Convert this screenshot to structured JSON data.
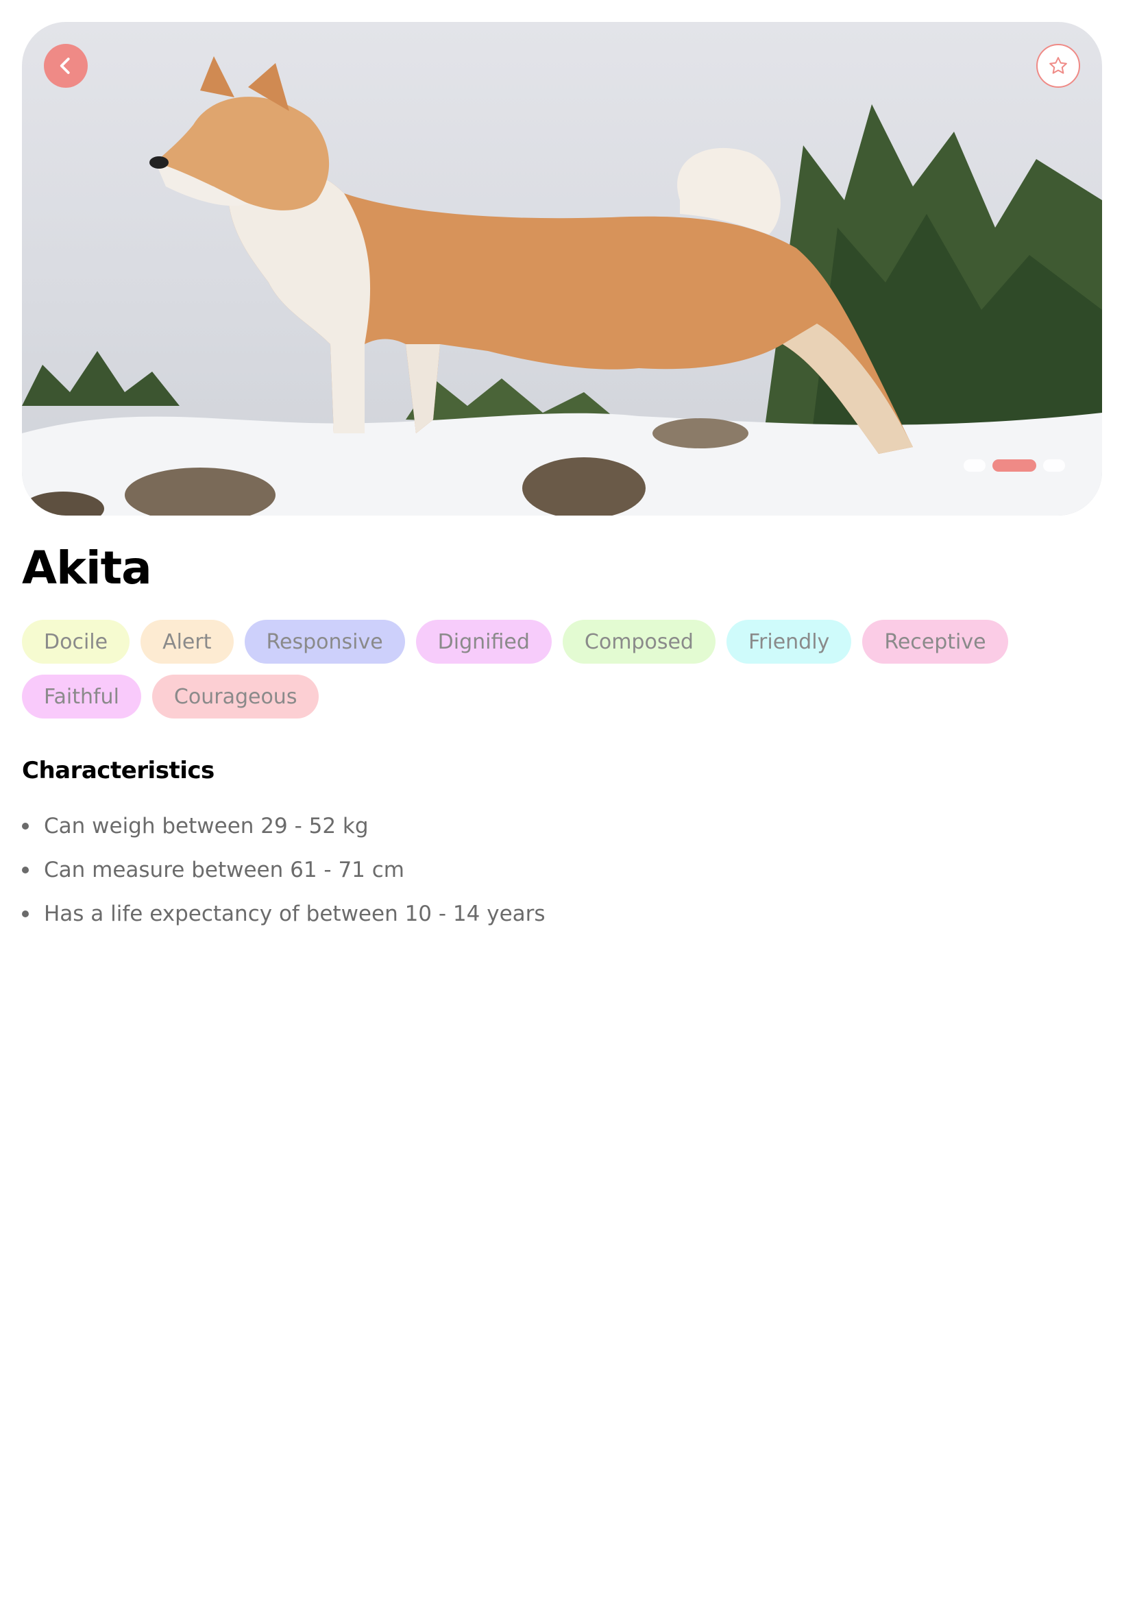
{
  "header": {
    "back_icon": "chevron-left-icon",
    "favorite_icon": "star-outline-icon"
  },
  "gallery": {
    "image_subject": "Akita dog standing in snow",
    "slides": 3,
    "active_slide": 2
  },
  "breed": {
    "name": "Akita"
  },
  "tags": [
    {
      "label": "Docile",
      "color": "#f6fbd0"
    },
    {
      "label": "Alert",
      "color": "#fdebd2"
    },
    {
      "label": "Responsive",
      "color": "#cdd0fb"
    },
    {
      "label": "Dignified",
      "color": "#f7ccfb"
    },
    {
      "label": "Composed",
      "color": "#e3fbd2"
    },
    {
      "label": "Friendly",
      "color": "#cffbfb"
    },
    {
      "label": "Receptive",
      "color": "#fbcce6"
    },
    {
      "label": "Faithful",
      "color": "#f9cafb"
    },
    {
      "label": "Courageous",
      "color": "#fccfd3"
    }
  ],
  "characteristics": {
    "title": "Characteristics",
    "items": [
      "Can weigh between 29 - 52 kg",
      "Can measure between 61 - 71 cm",
      "Has a life expectancy of between 10 - 14 years"
    ]
  },
  "colors": {
    "accent": "#ef8a86",
    "tag_text": "#8a8a8a",
    "body_text": "#6b6b6b"
  }
}
